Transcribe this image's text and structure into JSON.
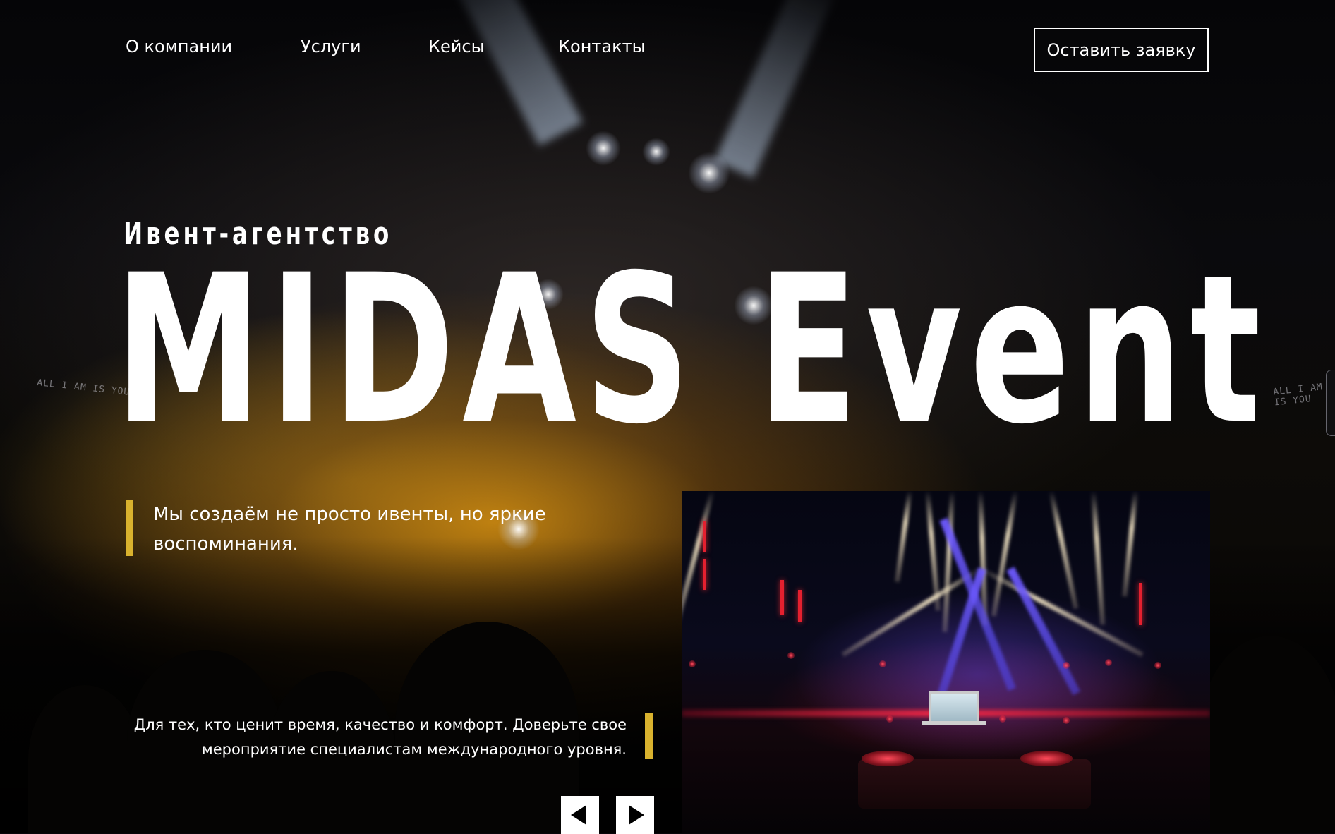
{
  "nav": {
    "items": [
      {
        "label": "О компании"
      },
      {
        "label": "Услуги"
      },
      {
        "label": "Кейсы"
      },
      {
        "label": "Контакты"
      }
    ],
    "cta_label": "Оставить заявку"
  },
  "hero": {
    "eyebrow": "Ивент-агентство",
    "title": "MIDAS Event",
    "tagline": "Мы создаём не просто ивенты, но яркие воспоминания.",
    "subtext": "Для тех, кто ценит время, качество и комфорт. Доверьте свое мероприятие специалистам международного уровня.",
    "background_text": "ALL I AM IS YOU"
  },
  "slider": {
    "prev_icon": "triangle-left-icon",
    "next_icon": "triangle-right-icon"
  },
  "colors": {
    "accent": "#d9b22e",
    "text": "#ffffff",
    "background": "#07060a",
    "button_bg": "#ffffff",
    "arrow": "#000000"
  }
}
